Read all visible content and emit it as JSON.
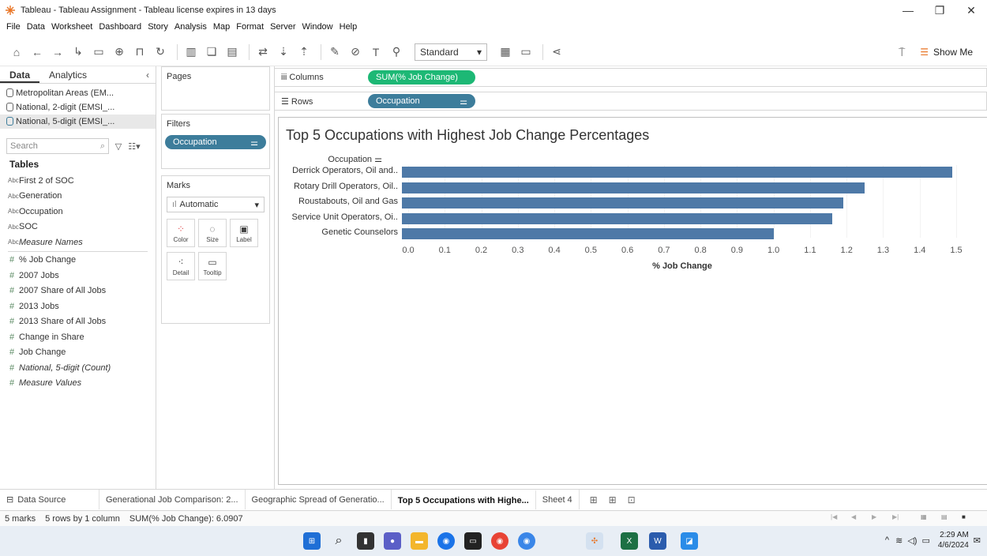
{
  "window": {
    "title": "Tableau - Tableau Assignment - Tableau license expires in 13 days"
  },
  "menu": [
    "File",
    "Data",
    "Worksheet",
    "Dashboard",
    "Story",
    "Analysis",
    "Map",
    "Format",
    "Server",
    "Window",
    "Help"
  ],
  "toolbar": {
    "fit_select": "Standard",
    "show_me": "Show Me"
  },
  "data_pane": {
    "tab_data": "Data",
    "tab_analytics": "Analytics",
    "sources": [
      "Metropolitan Areas (EM...",
      "National, 2-digit (EMSI_...",
      "National, 5-digit (EMSI_..."
    ],
    "search_placeholder": "Search",
    "tables_header": "Tables",
    "dimensions": [
      {
        "type": "Abc",
        "label": "First 2 of SOC"
      },
      {
        "type": "Abc",
        "label": "Generation"
      },
      {
        "type": "Abc",
        "label": "Occupation"
      },
      {
        "type": "Abc",
        "label": "SOC"
      },
      {
        "type": "Abc",
        "label": "Measure Names"
      }
    ],
    "measures": [
      {
        "type": "#",
        "label": "% Job Change"
      },
      {
        "type": "#",
        "label": "2007 Jobs"
      },
      {
        "type": "#",
        "label": "2007 Share of All Jobs"
      },
      {
        "type": "#",
        "label": "2013 Jobs"
      },
      {
        "type": "#",
        "label": "2013 Share of All Jobs"
      },
      {
        "type": "#",
        "label": "Change in Share"
      },
      {
        "type": "#",
        "label": "Job Change"
      },
      {
        "type": "#",
        "label": "National, 5-digit (Count)"
      },
      {
        "type": "#",
        "label": "Measure Values"
      }
    ]
  },
  "cards": {
    "pages": "Pages",
    "filters": "Filters",
    "filter_pill": "Occupation",
    "marks": "Marks",
    "marks_type": "Automatic",
    "mark_buttons": [
      "Color",
      "Size",
      "Label",
      "Detail",
      "Tooltip"
    ]
  },
  "shelves": {
    "columns_label": "Columns",
    "columns_pill": "SUM(% Job Change)",
    "rows_label": "Rows",
    "rows_pill": "Occupation"
  },
  "chart_data": {
    "type": "bar",
    "orientation": "horizontal",
    "title": "Top 5 Occupations with Highest Job Change Percentages",
    "ylabel": "Occupation",
    "xlabel": "% Job Change",
    "categories": [
      "Derrick Operators, Oil and..",
      "Rotary Drill Operators, Oil..",
      "Roustabouts, Oil and Gas",
      "Service Unit Operators, Oi..",
      "Genetic Counselors"
    ],
    "values": [
      1.49,
      1.25,
      1.19,
      1.16,
      1.0
    ],
    "xlim": [
      0,
      1.5
    ],
    "xticks": [
      "0.0",
      "0.1",
      "0.2",
      "0.3",
      "0.4",
      "0.5",
      "0.6",
      "0.7",
      "0.8",
      "0.9",
      "1.0",
      "1.1",
      "1.2",
      "1.3",
      "1.4",
      "1.5"
    ],
    "color": "#4e79a7",
    "grid": true
  },
  "sheet_tabs": {
    "data_source": "Data Source",
    "tabs": [
      "Generational Job Comparison: 2...",
      "Geographic Spread of Generatio...",
      "Top 5 Occupations with Highe...",
      "Sheet 4"
    ],
    "active_index": 2
  },
  "status": {
    "marks": "5 marks",
    "dims": "5 rows by 1 column",
    "sum": "SUM(% Job Change): 6.0907"
  },
  "taskbar": {
    "time": "2:29 AM",
    "date": "4/6/2024"
  }
}
